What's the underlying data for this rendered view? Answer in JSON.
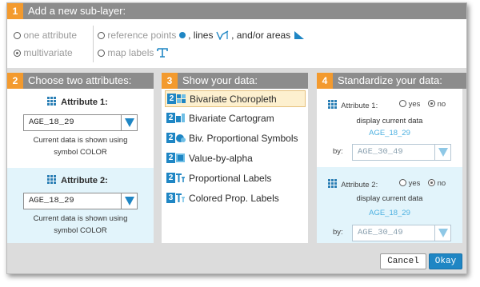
{
  "section1": {
    "number": "1",
    "title": "Add a new sub-layer:",
    "options": {
      "one_attribute": "one attribute",
      "multivariate": "multivariate",
      "reference_points": "reference points",
      "lines_sep": ", lines",
      "areas_sep": ", and/or areas",
      "map_labels": "map labels"
    }
  },
  "section2": {
    "number": "2",
    "title": "Choose two attributes:",
    "attr1": {
      "label": "Attribute 1:",
      "value": "AGE_18_29",
      "note1": "Current data is shown using",
      "note2": "symbol COLOR"
    },
    "attr2": {
      "label": "Attribute 2:",
      "value": "AGE_18_29",
      "note1": "Current data is shown using",
      "note2": "symbol COLOR"
    }
  },
  "section3": {
    "number": "3",
    "title": "Show your data:",
    "items": [
      {
        "num": "2",
        "label": "Bivariate Choropleth",
        "icon": "choropleth-icon"
      },
      {
        "num": "2",
        "label": "Bivariate Cartogram",
        "icon": "cartogram-icon"
      },
      {
        "num": "2",
        "label": "Biv. Proportional Symbols",
        "icon": "proportional-symbols-icon"
      },
      {
        "num": "2",
        "label": "Value-by-alpha",
        "icon": "value-by-alpha-icon"
      },
      {
        "num": "2",
        "label": "Proportional Labels",
        "icon": "proportional-labels-icon"
      },
      {
        "num": "3",
        "label": "Colored Prop. Labels",
        "icon": "colored-prop-labels-icon"
      }
    ]
  },
  "section4": {
    "number": "4",
    "title": "Standardize your data:",
    "attr1": {
      "label": "Attribute 1:",
      "yes": "yes",
      "no": "no",
      "display": "display current data",
      "current": "AGE_18_29",
      "by": "by:",
      "value": "AGE_30_49"
    },
    "attr2": {
      "label": "Attribute 2:",
      "yes": "yes",
      "no": "no",
      "display": "display current data",
      "current": "AGE_18_29",
      "by": "by:",
      "value": "AGE_30_49"
    }
  },
  "buttons": {
    "cancel": "Cancel",
    "ok": "Okay"
  },
  "colors": {
    "accent": "#1f86c4",
    "step": "#f39a2e",
    "bar": "#8c8c8c",
    "highlight": "#fdf0cf",
    "light_blue_pane": "#e2f4fb"
  }
}
